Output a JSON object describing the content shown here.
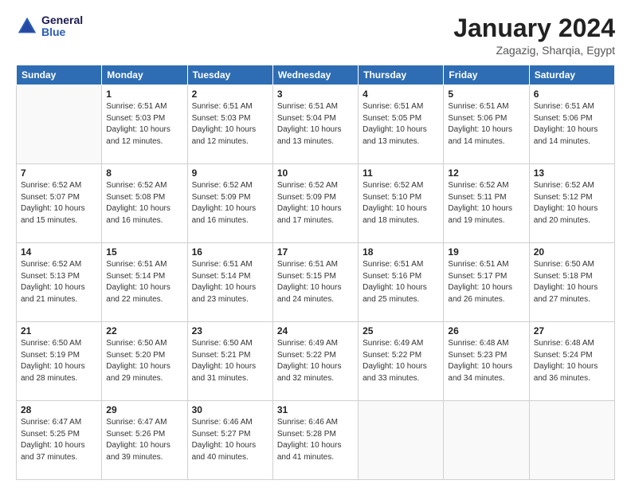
{
  "header": {
    "logo": {
      "general": "General",
      "blue": "Blue"
    },
    "title": "January 2024",
    "subtitle": "Zagazig, Sharqia, Egypt"
  },
  "weekdays": [
    "Sunday",
    "Monday",
    "Tuesday",
    "Wednesday",
    "Thursday",
    "Friday",
    "Saturday"
  ],
  "weeks": [
    [
      {
        "day": "",
        "info": ""
      },
      {
        "day": "1",
        "info": "Sunrise: 6:51 AM\nSunset: 5:03 PM\nDaylight: 10 hours\nand 12 minutes."
      },
      {
        "day": "2",
        "info": "Sunrise: 6:51 AM\nSunset: 5:03 PM\nDaylight: 10 hours\nand 12 minutes."
      },
      {
        "day": "3",
        "info": "Sunrise: 6:51 AM\nSunset: 5:04 PM\nDaylight: 10 hours\nand 13 minutes."
      },
      {
        "day": "4",
        "info": "Sunrise: 6:51 AM\nSunset: 5:05 PM\nDaylight: 10 hours\nand 13 minutes."
      },
      {
        "day": "5",
        "info": "Sunrise: 6:51 AM\nSunset: 5:06 PM\nDaylight: 10 hours\nand 14 minutes."
      },
      {
        "day": "6",
        "info": "Sunrise: 6:51 AM\nSunset: 5:06 PM\nDaylight: 10 hours\nand 14 minutes."
      }
    ],
    [
      {
        "day": "7",
        "info": "Sunrise: 6:52 AM\nSunset: 5:07 PM\nDaylight: 10 hours\nand 15 minutes."
      },
      {
        "day": "8",
        "info": "Sunrise: 6:52 AM\nSunset: 5:08 PM\nDaylight: 10 hours\nand 16 minutes."
      },
      {
        "day": "9",
        "info": "Sunrise: 6:52 AM\nSunset: 5:09 PM\nDaylight: 10 hours\nand 16 minutes."
      },
      {
        "day": "10",
        "info": "Sunrise: 6:52 AM\nSunset: 5:09 PM\nDaylight: 10 hours\nand 17 minutes."
      },
      {
        "day": "11",
        "info": "Sunrise: 6:52 AM\nSunset: 5:10 PM\nDaylight: 10 hours\nand 18 minutes."
      },
      {
        "day": "12",
        "info": "Sunrise: 6:52 AM\nSunset: 5:11 PM\nDaylight: 10 hours\nand 19 minutes."
      },
      {
        "day": "13",
        "info": "Sunrise: 6:52 AM\nSunset: 5:12 PM\nDaylight: 10 hours\nand 20 minutes."
      }
    ],
    [
      {
        "day": "14",
        "info": "Sunrise: 6:52 AM\nSunset: 5:13 PM\nDaylight: 10 hours\nand 21 minutes."
      },
      {
        "day": "15",
        "info": "Sunrise: 6:51 AM\nSunset: 5:14 PM\nDaylight: 10 hours\nand 22 minutes."
      },
      {
        "day": "16",
        "info": "Sunrise: 6:51 AM\nSunset: 5:14 PM\nDaylight: 10 hours\nand 23 minutes."
      },
      {
        "day": "17",
        "info": "Sunrise: 6:51 AM\nSunset: 5:15 PM\nDaylight: 10 hours\nand 24 minutes."
      },
      {
        "day": "18",
        "info": "Sunrise: 6:51 AM\nSunset: 5:16 PM\nDaylight: 10 hours\nand 25 minutes."
      },
      {
        "day": "19",
        "info": "Sunrise: 6:51 AM\nSunset: 5:17 PM\nDaylight: 10 hours\nand 26 minutes."
      },
      {
        "day": "20",
        "info": "Sunrise: 6:50 AM\nSunset: 5:18 PM\nDaylight: 10 hours\nand 27 minutes."
      }
    ],
    [
      {
        "day": "21",
        "info": "Sunrise: 6:50 AM\nSunset: 5:19 PM\nDaylight: 10 hours\nand 28 minutes."
      },
      {
        "day": "22",
        "info": "Sunrise: 6:50 AM\nSunset: 5:20 PM\nDaylight: 10 hours\nand 29 minutes."
      },
      {
        "day": "23",
        "info": "Sunrise: 6:50 AM\nSunset: 5:21 PM\nDaylight: 10 hours\nand 31 minutes."
      },
      {
        "day": "24",
        "info": "Sunrise: 6:49 AM\nSunset: 5:22 PM\nDaylight: 10 hours\nand 32 minutes."
      },
      {
        "day": "25",
        "info": "Sunrise: 6:49 AM\nSunset: 5:22 PM\nDaylight: 10 hours\nand 33 minutes."
      },
      {
        "day": "26",
        "info": "Sunrise: 6:48 AM\nSunset: 5:23 PM\nDaylight: 10 hours\nand 34 minutes."
      },
      {
        "day": "27",
        "info": "Sunrise: 6:48 AM\nSunset: 5:24 PM\nDaylight: 10 hours\nand 36 minutes."
      }
    ],
    [
      {
        "day": "28",
        "info": "Sunrise: 6:47 AM\nSunset: 5:25 PM\nDaylight: 10 hours\nand 37 minutes."
      },
      {
        "day": "29",
        "info": "Sunrise: 6:47 AM\nSunset: 5:26 PM\nDaylight: 10 hours\nand 39 minutes."
      },
      {
        "day": "30",
        "info": "Sunrise: 6:46 AM\nSunset: 5:27 PM\nDaylight: 10 hours\nand 40 minutes."
      },
      {
        "day": "31",
        "info": "Sunrise: 6:46 AM\nSunset: 5:28 PM\nDaylight: 10 hours\nand 41 minutes."
      },
      {
        "day": "",
        "info": ""
      },
      {
        "day": "",
        "info": ""
      },
      {
        "day": "",
        "info": ""
      }
    ]
  ]
}
